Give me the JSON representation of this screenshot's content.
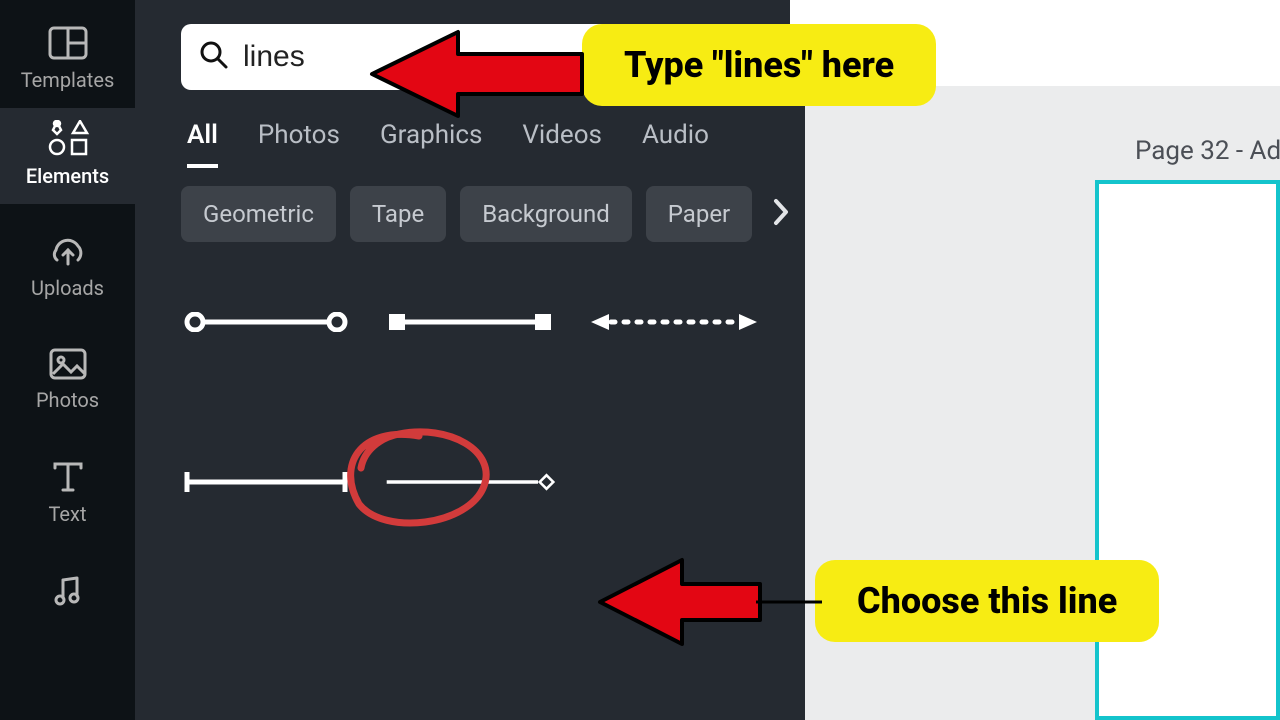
{
  "nav": {
    "items": [
      {
        "label": "Templates",
        "icon": "templates"
      },
      {
        "label": "Elements",
        "icon": "elements"
      },
      {
        "label": "Uploads",
        "icon": "uploads"
      },
      {
        "label": "Photos",
        "icon": "photos"
      },
      {
        "label": "Text",
        "icon": "text"
      },
      {
        "label": "Audio",
        "icon": "audio"
      }
    ],
    "active": 1
  },
  "search": {
    "value": "lines"
  },
  "tabs": {
    "items": [
      {
        "label": "All"
      },
      {
        "label": "Photos"
      },
      {
        "label": "Graphics"
      },
      {
        "label": "Videos"
      },
      {
        "label": "Audio"
      }
    ],
    "active": 0
  },
  "chips": [
    "Geometric",
    "Tape",
    "Background",
    "Paper"
  ],
  "results": {
    "row1": [
      {
        "name": "line-circle-ends"
      },
      {
        "name": "line-square-ends"
      },
      {
        "name": "line-dotted-arrow"
      }
    ],
    "row2": [
      {
        "name": "line-flat-ends"
      },
      {
        "name": "line-plain-diamond"
      }
    ]
  },
  "canvas": {
    "page_label": "Page 32 - Ad"
  },
  "annotations": {
    "type_here": "Type \"lines\" here",
    "choose": "Choose this line"
  }
}
